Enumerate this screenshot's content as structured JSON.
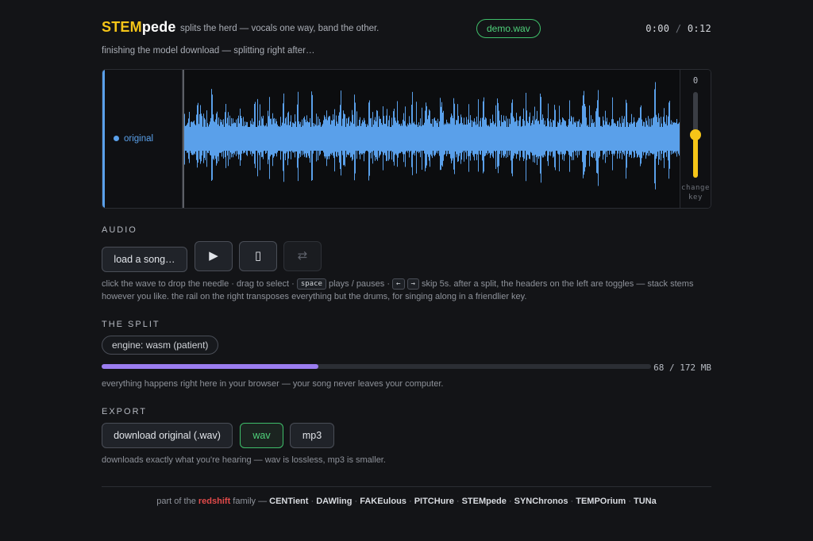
{
  "header": {
    "brand_part1": "STEM",
    "brand_part2": "pede",
    "tagline": "splits the herd — vocals one way, band the other.",
    "file_name": "demo.wav",
    "time_current": "0:00",
    "time_separator": "/",
    "time_total": "0:12",
    "status": "finishing the model download — splitting right after…"
  },
  "waveform": {
    "track_label": "original",
    "track_color": "#5aa0ea",
    "transpose_value": "0",
    "transpose_level": 0.5,
    "transpose_color": "#f5c518",
    "transpose_caption_line1": "change",
    "transpose_caption_line2": "key"
  },
  "audio": {
    "title": "AUDIO",
    "load_label": "load a song…",
    "play_icon": "play-icon",
    "play_glyph": "▶",
    "device_icon": "phone-icon",
    "device_glyph": "▯",
    "loop_icon": "loop-icon",
    "loop_glyph": "⇄",
    "help_part1": "click the wave to drop the needle · drag to select ·",
    "key_space": "space",
    "help_part2": "plays / pauses ·",
    "key_left": "←",
    "key_right": "→",
    "help_part3": "skip 5s. after a split, the headers on the left are toggles — stack stems",
    "help_line2": "however you like. the rail on the right transposes everything but the drums, for singing along in a friendlier key."
  },
  "split": {
    "title": "THE SPLIT",
    "engine_label": "engine: wasm (patient)",
    "progress_fraction": 0.395,
    "progress_color": "#9b7df0",
    "progress_text": "68 / 172 MB",
    "note": "everything happens right here in your browser — your song never leaves your computer."
  },
  "export": {
    "title": "EXPORT",
    "download_label": "download original (.wav)",
    "format_wav": "wav",
    "format_mp3": "mp3",
    "selected_format": "wav",
    "note": "downloads exactly what you're hearing — wav is lossless, mp3 is smaller."
  },
  "footer": {
    "prefix": "part of the",
    "family_name": "redshift",
    "family_suffix": "family —",
    "apps": [
      "CENTient",
      "DAWling",
      "FAKEulous",
      "PITCHure",
      "STEMpede",
      "SYNChronos",
      "TEMPOrium",
      "TUNa"
    ],
    "separator": "·"
  }
}
